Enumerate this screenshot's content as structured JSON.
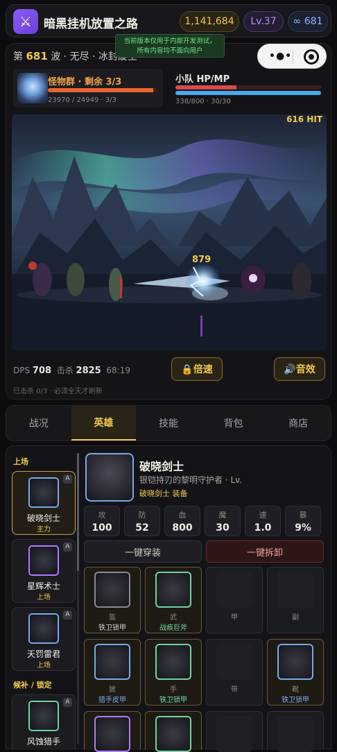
{
  "header": {
    "title": "暗黑挂机放置之路",
    "gold": "1,141,684",
    "level": "Lv.37",
    "infinite": "∞ 681"
  },
  "notice": {
    "line1": "当前版本仅用于内部开发测试，",
    "line2": "所有内容均不面向用户"
  },
  "battle": {
    "wave_prefix": "第",
    "wave_num": "681",
    "wave_suffix": "波 · 无尽 · 冰封废土",
    "enemy": {
      "name": "怪物群 · 剩余 3/3",
      "hp_text": "23970 / 24949 · 3/3",
      "hp_fraction": 0.96
    },
    "team": {
      "name": "小队 HP/MP",
      "hp_text": "338/800 · 30/30",
      "hp_fraction": 0.42,
      "mp_fraction": 1.0
    },
    "hit": "616 HIT",
    "dmg": "879",
    "dps_label": "DPS",
    "dps": "708",
    "kills_label": "击杀",
    "kills": "2825",
    "time": "68:19",
    "speed_btn": "🔒倍速",
    "sound_btn": "🔊音效",
    "killed_line": "已击杀 0/3 · 必须全灭才刷新"
  },
  "tabs": [
    "战况",
    "英雄",
    "技能",
    "背包",
    "商店"
  ],
  "heroes": {
    "section_active": "上场",
    "section_bench": "候补 / 锁定",
    "list": [
      {
        "name": "破晓剑士",
        "status": "主力",
        "badge": "A"
      },
      {
        "name": "星辉术士",
        "status": "上场",
        "badge": "A"
      },
      {
        "name": "天罚雷君",
        "status": "上场",
        "badge": "A"
      },
      {
        "name": "风蚀猎手",
        "status": "",
        "badge": "A"
      }
    ]
  },
  "detail": {
    "name": "破晓剑士",
    "subtitle": "银铠持刃的黎明守护者 · Lv.",
    "class_line": "破晓剑士 装备",
    "stats": [
      {
        "k": "攻",
        "v": "100"
      },
      {
        "k": "防",
        "v": "52"
      },
      {
        "k": "血",
        "v": "800"
      },
      {
        "k": "魔",
        "v": "30"
      },
      {
        "k": "速",
        "v": "1.0"
      },
      {
        "k": "暴",
        "v": "9%"
      }
    ],
    "equip_all": "一键穿装",
    "unequip_all": "一键拆卸",
    "slots": [
      {
        "label": "盔",
        "item": "铁卫锁甲"
      },
      {
        "label": "武",
        "item": "战痕巨斧"
      },
      {
        "label": "甲",
        "item": ""
      },
      {
        "label": "副",
        "item": ""
      },
      {
        "label": "披",
        "item": "猎手皮甲"
      },
      {
        "label": "手",
        "item": "铁卫锁甲"
      },
      {
        "label": "带",
        "item": ""
      },
      {
        "label": "靴",
        "item": "铁卫锁甲"
      }
    ]
  }
}
